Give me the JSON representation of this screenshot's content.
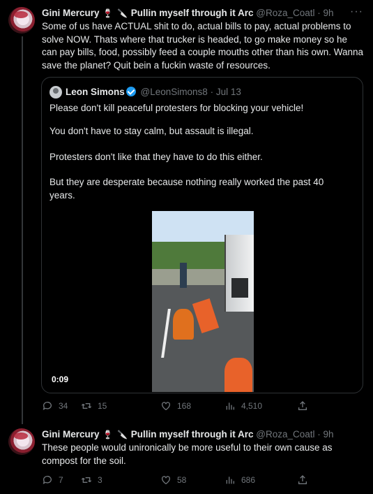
{
  "tweet1": {
    "name": "Gini Mercury",
    "emoji1": "🍷",
    "emoji2": "🔪",
    "name_suffix": "Pullin myself through it Arc",
    "handle": "@Roza_Coatl",
    "separator": "·",
    "time": "9h",
    "more": "···",
    "text": "Some of us have ACTUAL shit to do, actual bills to pay, actual problems to solve NOW. Thats where that trucker is headed, to go make money so he can pay bills, food, possibly feed a couple mouths other than his own. Wanna save the planet? Quit bein a fuckin waste of resources.",
    "quote": {
      "name": "Leon Simons",
      "handle": "@LeonSimons8",
      "separator": "·",
      "date": "Jul 13",
      "paragraphs": [
        "Please don't kill peaceful protesters for blocking your vehicle!",
        "You don't have to stay calm, but assault is illegal.",
        "Protesters don't like that they have to do this either.",
        "But they are desperate because nothing really worked the past 40 years."
      ],
      "video_duration": "0:09"
    },
    "stats": {
      "replies": "34",
      "retweets": "15",
      "likes": "168",
      "views": "4,510"
    }
  },
  "tweet2": {
    "name": "Gini Mercury",
    "emoji1": "🍷",
    "emoji2": "🔪",
    "name_suffix": "Pullin myself through it Arc",
    "handle": "@Roza_Coatl",
    "separator": "·",
    "time": "9h",
    "more": "···",
    "text": "These people would unironically be more useful to their own cause as compost for the soil.",
    "stats": {
      "replies": "7",
      "retweets": "3",
      "likes": "58",
      "views": "686"
    }
  },
  "icons": [
    "reply-icon",
    "retweet-icon",
    "like-icon",
    "views-icon",
    "share-icon",
    "verified-icon",
    "more-icon"
  ]
}
